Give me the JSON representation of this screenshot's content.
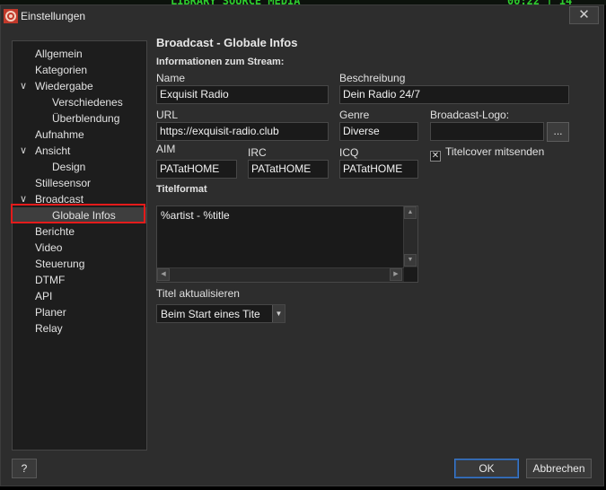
{
  "background_app": {
    "text_left": "LIBRARY SOURCE MEDIA",
    "text_right": "00:22 |  14"
  },
  "window": {
    "title": "Einstellungen",
    "close_label": "✕"
  },
  "nav": {
    "items": [
      {
        "label": "Allgemein"
      },
      {
        "label": "Kategorien"
      },
      {
        "label": "Wiedergabe",
        "arrow": "∨"
      },
      {
        "label": "Verschiedenes"
      },
      {
        "label": "Überblendung"
      },
      {
        "label": "Aufnahme"
      },
      {
        "label": "Ansicht",
        "arrow": "∨"
      },
      {
        "label": "Design"
      },
      {
        "label": "Stillesensor"
      },
      {
        "label": "Broadcast",
        "arrow": "∨"
      },
      {
        "label": "Globale Infos"
      },
      {
        "label": "Berichte"
      },
      {
        "label": "Video"
      },
      {
        "label": "Steuerung"
      },
      {
        "label": "DTMF"
      },
      {
        "label": "API"
      },
      {
        "label": "Planer"
      },
      {
        "label": "Relay"
      }
    ],
    "selected": "Globale Infos",
    "highlight_color": "#e41b1b"
  },
  "panel": {
    "title": "Broadcast - Globale Infos",
    "stream_info_label": "Informationen zum Stream:",
    "name": {
      "label": "Name",
      "value": "Exquisit Radio"
    },
    "description": {
      "label": "Beschreibung",
      "value": "Dein Radio 24/7"
    },
    "url": {
      "label": "URL",
      "value": "https://exquisit-radio.club"
    },
    "genre": {
      "label": "Genre",
      "value": "Diverse"
    },
    "logo": {
      "label": "Broadcast-Logo:",
      "value": "",
      "browse_label": "..."
    },
    "aim": {
      "label": "AIM",
      "value": "PATatHOME"
    },
    "irc": {
      "label": "IRC",
      "value": "PATatHOME"
    },
    "icq": {
      "label": "ICQ",
      "value": "PATatHOME"
    },
    "title_cover": {
      "label": "Titelcover mitsenden",
      "checked": true,
      "mark": "✕"
    },
    "title_format": {
      "label": "Titelformat",
      "value": "%artist - %title"
    },
    "title_update": {
      "label": "Titel aktualisieren",
      "value": "Beim Start eines Tite"
    }
  },
  "footer": {
    "help_label": "?",
    "ok_label": "OK",
    "cancel_label": "Abbrechen"
  },
  "colors": {
    "window_bg": "#2d2d2d",
    "field_bg": "#1a1a1a",
    "accent_ok": "#3c78c8"
  }
}
